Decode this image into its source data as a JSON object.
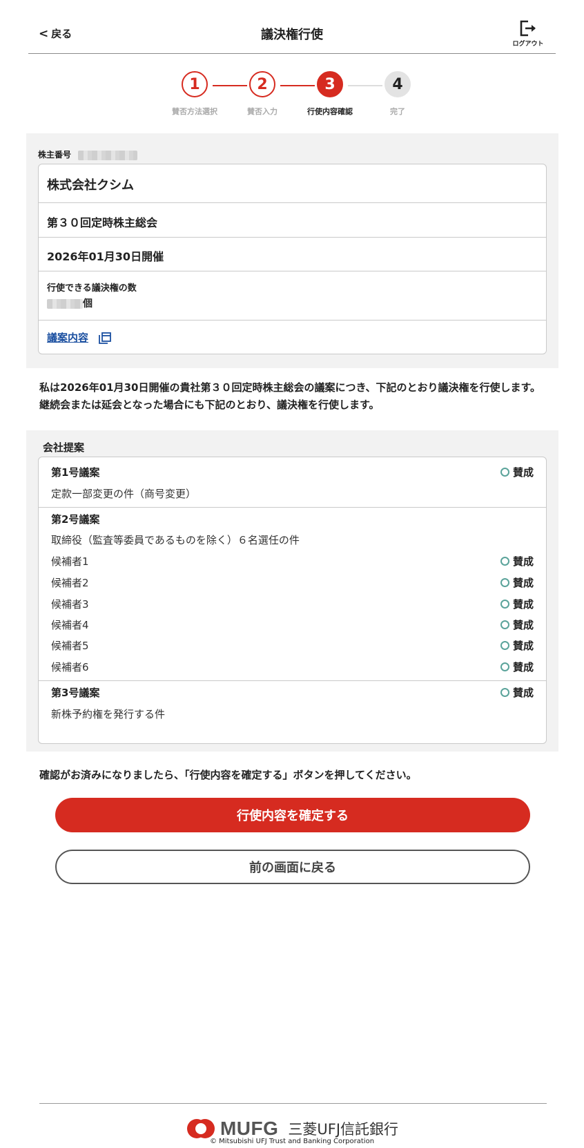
{
  "header": {
    "back_label": "戻る",
    "title": "議決権行使",
    "logout_label": "ログアウト"
  },
  "steps": [
    {
      "num": "1",
      "label": "賛否方法選択",
      "state": "done"
    },
    {
      "num": "2",
      "label": "賛否入力",
      "state": "done"
    },
    {
      "num": "3",
      "label": "行使内容確認",
      "state": "current"
    },
    {
      "num": "4",
      "label": "完了",
      "state": "upcoming"
    }
  ],
  "info": {
    "holder_label": "株主番号",
    "company": "株式会社クシム",
    "meeting": "第３０回定時株主総会",
    "date": "2026年01月30日開催",
    "votes_label": "行使できる議決権の数",
    "votes_unit": "個",
    "proposal_link": "議案内容"
  },
  "statement": "私は2026年01月30日開催の貴社第３０回定時株主総会の議案につき、下記のとおり議決権を行使します。 継続会または延会となった場合にも下記のとおり、議決権を行使します。",
  "proposals": {
    "heading": "会社提案",
    "vote_label": "賛成",
    "p1_title": "第1号議案",
    "p1_desc": "定款一部変更の件（商号変更）",
    "p2_title": "第2号議案",
    "p2_desc": "取締役（監査等委員であるものを除く）６名選任の件",
    "candidates": [
      "候補者1",
      "候補者2",
      "候補者3",
      "候補者4",
      "候補者5",
      "候補者6"
    ],
    "p3_title": "第3号議案",
    "p3_desc": "新株予約権を発行する件"
  },
  "confirm_note": "確認がお済みになりましたら、「行使内容を確定する」ボタンを押してください。",
  "buttons": {
    "confirm": "行使内容を確定する",
    "back": "前の画面に戻る"
  },
  "footer": {
    "logo_text": "MUFG",
    "bank_name": "三菱UFJ信託銀行",
    "copyright": "© Mitsubishi UFJ Trust and Banking Corporation"
  },
  "colors": {
    "accent": "#d62b20",
    "radio": "#5aa39a",
    "panel": "#f2f2f2",
    "link": "#1a4fa0"
  }
}
